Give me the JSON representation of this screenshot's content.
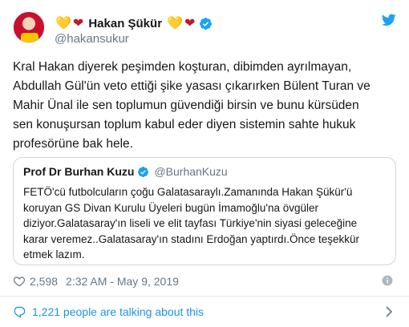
{
  "colors": {
    "link": "#1b95e0",
    "secondary": "#657786",
    "text": "#14171a",
    "border": "#ccd6dd",
    "verified": "#1da1f2"
  },
  "author": {
    "avatar_icon": "avatar-photo",
    "display_name": "Hakan Şükür",
    "emoji_left": [
      "💛",
      "❤"
    ],
    "emoji_right": [
      "💛",
      "❤"
    ],
    "handle": "@hakansukur",
    "verified": true
  },
  "brand_icon": "twitter-bird-icon",
  "tweet": {
    "lines": [
      "Kral Hakan diyerek peşimden koşturan, dibimden ayrılmayan,",
      "Abdullah Gül'ün veto ettiği şike yasası çıkarırken Bülent Turan ve",
      "Mahir Ünal ile  sen toplumun güvendiği birsin ve bunu kürsüden",
      "sen konuşursan toplum kabul eder diyen sistemin sahte hukuk",
      "profesörüne bak hele."
    ]
  },
  "quoted_tweet": {
    "display_name": "Prof Dr Burhan Kuzu",
    "handle": "@BurhanKuzu",
    "verified": true,
    "lines": [
      "FETÖ'cü futbolcuların çoğu Galatasaraylı.Zamanında Hakan Şükür'ü",
      "koruyan GS Divan Kurulu Üyeleri bugün İmamoğlu'na övgüler",
      "diziyor.Galatasaray'ın liseli ve elit tayfası Türkiye'nin siyasi geleceğine",
      "karar veremez..Galatasaray'ın stadını Erdoğan yaptırdı.Önce teşekkür",
      "etmek lazım."
    ]
  },
  "meta": {
    "like_count": "2,598",
    "timestamp": "2:32 AM - May 9, 2019"
  },
  "footer": {
    "talking_text": "1,221 people are talking about this"
  }
}
